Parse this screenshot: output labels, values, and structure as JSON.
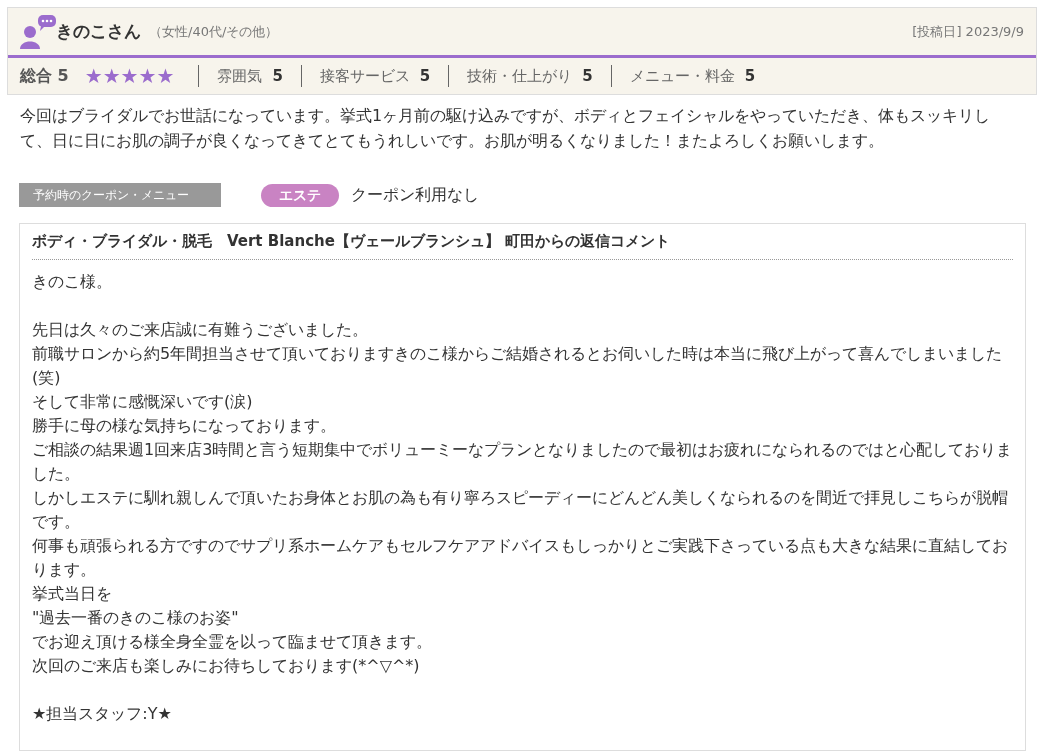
{
  "review": {
    "author": "きのこさん",
    "profile": "（女性/40代/その他）",
    "posted": "[投稿日] 2023/9/9",
    "overall": {
      "label": "総合",
      "score": "5",
      "stars": 5
    },
    "scores": [
      {
        "label": "雰囲気",
        "score": "5"
      },
      {
        "label": "接客サービス",
        "score": "5"
      },
      {
        "label": "技術・仕上がり",
        "score": "5"
      },
      {
        "label": "メニュー・料金",
        "score": "5"
      }
    ],
    "text": "今回はブライダルでお世話になっています。挙式1ヶ月前の駆け込みですが、ボディとフェイシャルをやっていただき、体もスッキリして、日に日にお肌の調子が良くなってきてとてもうれしいです。お肌が明るくなりました！またよろしくお願いします。",
    "coupon": {
      "label": "予約時のクーポン・メニュー",
      "tag": {
        "label": "エステ",
        "color": "#c983c3"
      },
      "value": "クーポン利用なし"
    }
  },
  "reply": {
    "title": "ボディ・ブライダル・脱毛　Vert Blanche【ヴェールブランシュ】 町田からの返信コメント",
    "paragraphs": [
      [
        "きのこ様。"
      ],
      [
        "先日は久々のご来店誠に有難うございました。",
        "前職サロンから約5年間担当させて頂いておりますきのこ様からご結婚されるとお伺いした時は本当に飛び上がって喜んでしまいました(笑)",
        "そして非常に感慨深いです(涙)",
        "勝手に母の様な気持ちになっております。",
        "ご相談の結果週1回来店3時間と言う短期集中でボリューミーなプランとなりましたので最初はお疲れになられるのではと心配しておりました。",
        "しかしエステに馴れ親しんで頂いたお身体とお肌の為も有り寧ろスピーディーにどんどん美しくなられるのを間近で拝見しこちらが脱帽です。",
        "何事も頑張られる方ですのでサプリ系ホームケアもセルフケアアドバイスもしっかりとご実践下さっている点も大きな結果に直結しております。",
        "挙式当日を",
        "\"過去一番のきのこ様のお姿\"",
        "でお迎え頂ける様全身全霊を以って臨ませて頂きます。",
        "次回のご来店も楽しみにお待ちしております(*^▽^*)"
      ],
      [
        "★担当スタッフ:Y★"
      ]
    ]
  }
}
